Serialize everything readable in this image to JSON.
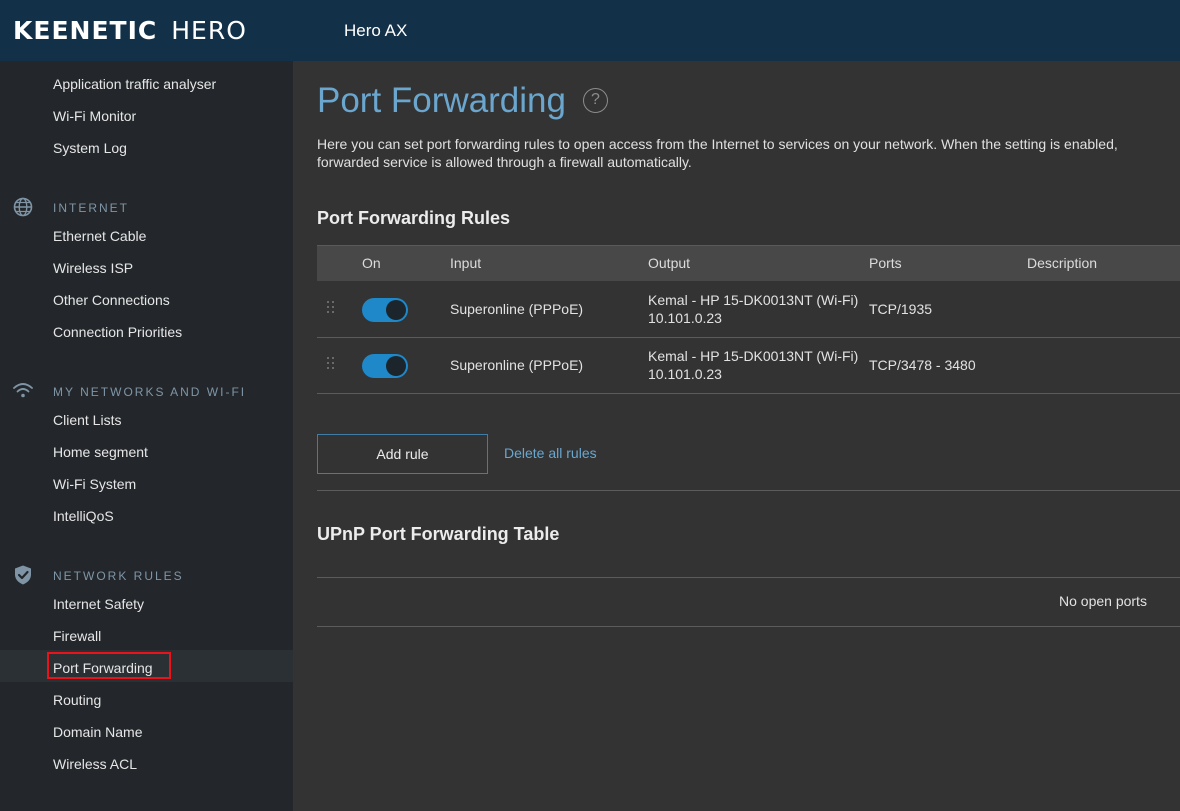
{
  "header": {
    "logo_brand": "KEENETIC",
    "logo_model": "HERO",
    "device_name": "Hero AX"
  },
  "sidebar": {
    "top_items": [
      "Application traffic analyser",
      "Wi-Fi Monitor",
      "System Log"
    ],
    "sections": [
      {
        "title": "INTERNET",
        "icon": "globe-icon",
        "items": [
          "Ethernet Cable",
          "Wireless ISP",
          "Other Connections",
          "Connection Priorities"
        ]
      },
      {
        "title": "MY NETWORKS AND WI-FI",
        "icon": "wifi-icon",
        "items": [
          "Client Lists",
          "Home segment",
          "Wi-Fi System",
          "IntelliQoS"
        ]
      },
      {
        "title": "NETWORK RULES",
        "icon": "shield-check-icon",
        "items": [
          "Internet Safety",
          "Firewall",
          "Port Forwarding",
          "Routing",
          "Domain Name",
          "Wireless ACL"
        ]
      }
    ],
    "active_item": "Port Forwarding"
  },
  "main": {
    "title": "Port Forwarding",
    "help_symbol": "?",
    "intro": "Here you can set port forwarding rules to open access from the Internet to services on your network. When the setting is enabled, forwarded service is allowed through a firewall automatically.",
    "rules_heading": "Port Forwarding Rules",
    "columns": [
      "On",
      "Input",
      "Output",
      "Ports",
      "Description"
    ],
    "rules": [
      {
        "enabled": true,
        "input": "Superonline (PPPoE)",
        "output_device": "Kemal - HP 15-DK0013NT (Wi-Fi)",
        "output_ip": "10.101.0.23",
        "ports": "TCP/1935",
        "description": ""
      },
      {
        "enabled": true,
        "input": "Superonline (PPPoE)",
        "output_device": "Kemal - HP 15-DK0013NT (Wi-Fi)",
        "output_ip": "10.101.0.23",
        "ports": "TCP/3478 - 3480",
        "description": ""
      }
    ],
    "add_rule_label": "Add rule",
    "delete_all_label": "Delete all rules",
    "upnp_heading": "UPnP Port Forwarding Table",
    "upnp_empty": "No open ports"
  },
  "colors": {
    "header_bg": "#123148",
    "sidebar_bg": "#23272b",
    "main_bg": "#333333",
    "accent": "#6aa6ce",
    "toggle_on": "#1e88c9",
    "highlight": "#e8131b"
  }
}
